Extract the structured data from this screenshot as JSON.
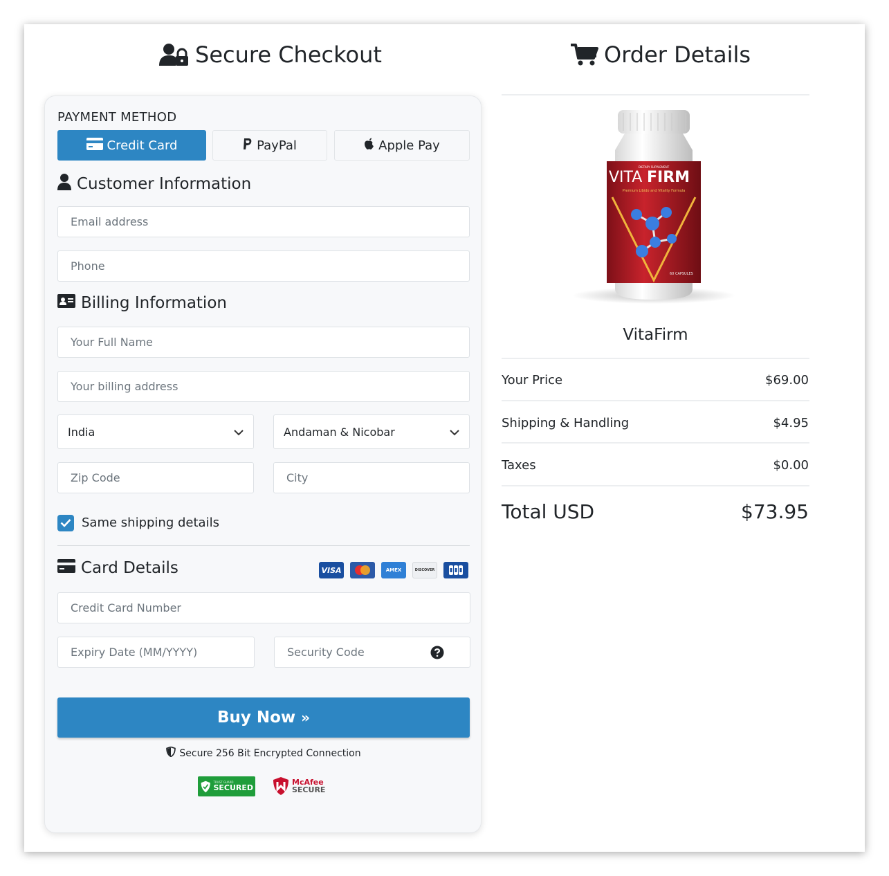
{
  "checkout": {
    "title": "Secure Checkout",
    "payment_method_label": "PAYMENT METHOD",
    "payment_tabs": [
      {
        "label": "Credit Card",
        "icon": "credit-card-icon",
        "active": true
      },
      {
        "label": "PayPal",
        "icon": "paypal-icon",
        "active": false
      },
      {
        "label": "Apple Pay",
        "icon": "apple-icon",
        "active": false
      }
    ],
    "customer_info": {
      "heading": "Customer Information",
      "email_placeholder": "Email address",
      "phone_placeholder": "Phone"
    },
    "billing_info": {
      "heading": "Billing Information",
      "name_placeholder": "Your Full Name",
      "address_placeholder": "Your billing address",
      "country_value": "India",
      "state_value": "Andaman & Nicobar",
      "zip_placeholder": "Zip Code",
      "city_placeholder": "City",
      "same_shipping_label": "Same shipping details",
      "same_shipping_checked": true
    },
    "card_details": {
      "heading": "Card Details",
      "card_brands": [
        "VISA",
        "Mastercard",
        "AMEX",
        "DISCOVER",
        "JCB"
      ],
      "card_number_placeholder": "Credit Card Number",
      "expiry_placeholder": "Expiry Date (MM/YYYY)",
      "security_placeholder": "Security Code"
    },
    "buy_button": "Buy Now",
    "secure_text": "Secure 256 Bit Encrypted Connection",
    "badges": {
      "trust_top": "TRUST GUARD",
      "trust_main": "SECURED",
      "mcafee_top": "McAfee",
      "mcafee_main": "SECURE"
    }
  },
  "order": {
    "title": "Order Details",
    "product": {
      "name": "VitaFirm",
      "label_text_1": "VITA",
      "label_text_2": "FIRM",
      "label_tag": "DIETARY SUPPLEMENT",
      "label_sub": "Premium Libido and Vitality Formula",
      "label_caps": "60 CAPSULES"
    },
    "rows": [
      {
        "label": "Your Price",
        "value": "$69.00"
      },
      {
        "label": "Shipping & Handling",
        "value": "$4.95"
      },
      {
        "label": "Taxes",
        "value": "$0.00"
      }
    ],
    "total_label": "Total USD",
    "total_value": "$73.95"
  },
  "colors": {
    "accent": "#2d86c3",
    "panel_bg": "#f7f8fa",
    "bottle_red": "#b3202a"
  }
}
